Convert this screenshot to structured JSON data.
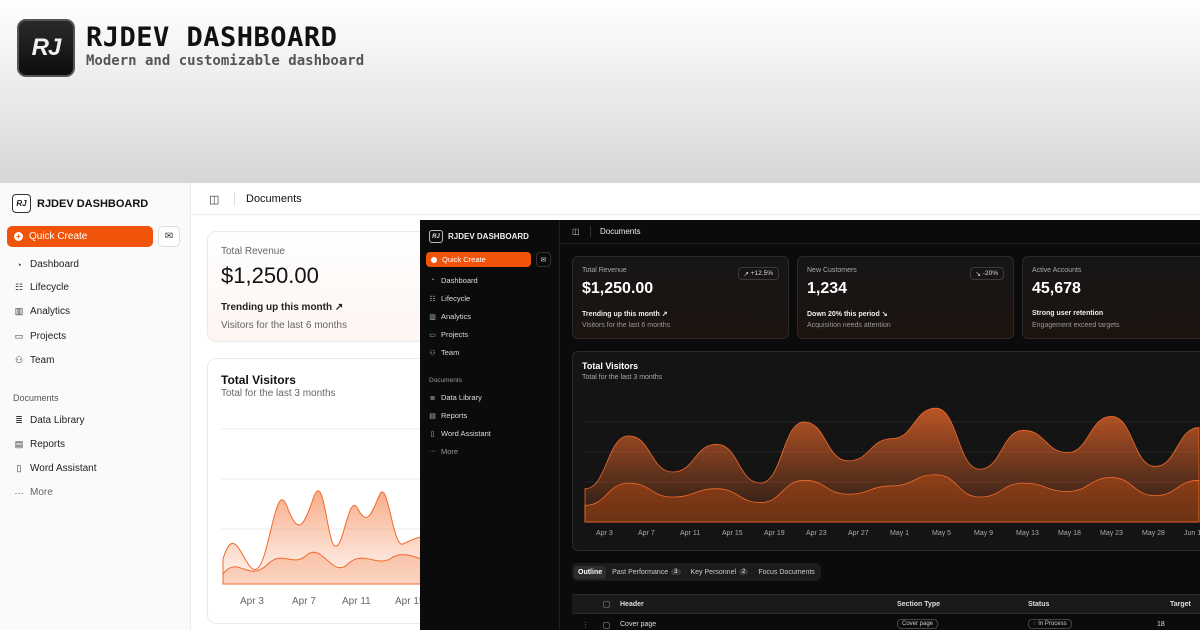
{
  "hero": {
    "logo_text": "RJ",
    "title": "RJDEV DASHBOARD",
    "subtitle": "Modern and customizable dashboard"
  },
  "light": {
    "brand": "RJDEV DASHBOARD",
    "logo_text": "RJ",
    "quick_create": "Quick Create",
    "nav": [
      "Dashboard",
      "Lifecycle",
      "Analytics",
      "Projects",
      "Team"
    ],
    "section": "Documents",
    "docs": [
      "Data Library",
      "Reports",
      "Word Assistant",
      "More"
    ],
    "breadcrumb": "Documents",
    "revenue": {
      "label": "Total Revenue",
      "value": "$1,250.00",
      "trend": "Trending up this month",
      "foot": "Visitors for the last 6 months"
    },
    "visitors": {
      "title": "Total Visitors",
      "subtitle": "Total for the last 3 months",
      "ticks": [
        "Apr 3",
        "Apr 7",
        "Apr 11",
        "Apr 15"
      ]
    }
  },
  "dark": {
    "brand": "RJDEV DASHBOARD",
    "logo_text": "RJ",
    "quick_create": "Quick Create",
    "nav": [
      "Dashboard",
      "Lifecycle",
      "Analytics",
      "Projects",
      "Team"
    ],
    "section": "Documents",
    "docs": [
      "Data Library",
      "Reports",
      "Word Assistant",
      "More"
    ],
    "breadcrumb": "Documents",
    "cards": [
      {
        "label": "Total Revenue",
        "value": "$1,250.00",
        "badge": "+12.5%",
        "trend": "Trending up this month",
        "foot": "Visitors for the last 6 months"
      },
      {
        "label": "New Customers",
        "value": "1,234",
        "badge": "-20%",
        "trend": "Down 20% this period",
        "foot": "Acquisition needs attention"
      },
      {
        "label": "Active Accounts",
        "value": "45,678",
        "badge": "",
        "trend": "Strong user retention",
        "foot": "Engagement exceed targets"
      }
    ],
    "chart": {
      "title": "Total Visitors",
      "subtitle": "Total for the last 3 months",
      "ticks": [
        "Apr 3",
        "Apr 7",
        "Apr 11",
        "Apr 15",
        "Apr 19",
        "Apr 23",
        "Apr 27",
        "May 1",
        "May 5",
        "May 9",
        "May 13",
        "May 18",
        "May 23",
        "May 28",
        "Jun 1"
      ]
    },
    "tabs": [
      {
        "label": "Outline",
        "count": ""
      },
      {
        "label": "Past Performance",
        "count": "3"
      },
      {
        "label": "Key Personnel",
        "count": "2"
      },
      {
        "label": "Focus Documents",
        "count": ""
      }
    ],
    "table": {
      "headers": {
        "header": "Header",
        "section_type": "Section Type",
        "status": "Status",
        "target": "Target"
      },
      "rows": [
        {
          "header": "Cover page",
          "section_type": "Cover page",
          "status": "In Process",
          "target": "18"
        }
      ]
    },
    "colors": {
      "accent": "#f0540a",
      "background": "#0b0b0b"
    }
  },
  "chart_data": {
    "type": "area",
    "title": "Total Visitors",
    "subtitle": "Total for the last 3 months",
    "x": [
      "Apr 3",
      "Apr 7",
      "Apr 11",
      "Apr 15",
      "Apr 19",
      "Apr 23",
      "Apr 27",
      "May 1",
      "May 5",
      "May 9",
      "May 13",
      "May 18",
      "May 23",
      "May 28",
      "Jun 1"
    ],
    "series": [
      {
        "values": [
          120,
          310,
          180,
          280,
          140,
          360,
          220,
          300,
          410,
          190,
          330,
          250,
          380,
          200,
          340
        ]
      },
      {
        "values": [
          60,
          140,
          90,
          120,
          70,
          150,
          100,
          130,
          170,
          90,
          140,
          110,
          160,
          95,
          150
        ]
      }
    ],
    "grid": true
  }
}
